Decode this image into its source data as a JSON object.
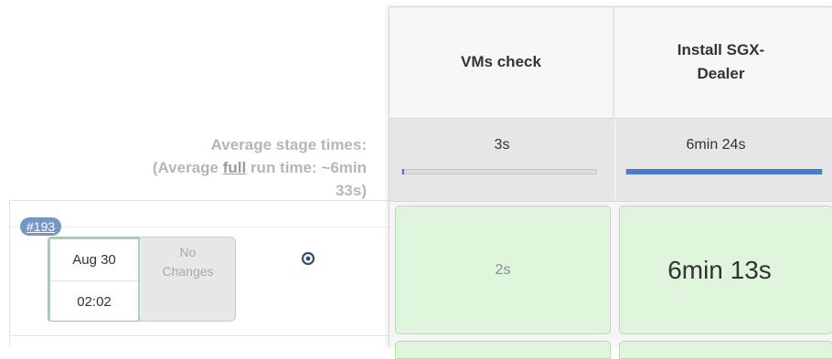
{
  "summary": {
    "avg_stage_label": "Average stage times:",
    "avg_full_prefix": "(Average ",
    "avg_full_link": "full",
    "avg_full_suffix": " run time: ~6min",
    "avg_full_last": "33s)"
  },
  "build": {
    "number": "#193",
    "date": "Aug 30",
    "time": "02:02",
    "changes_line1": "No",
    "changes_line2": "Changes",
    "info_icon": "info-circle-icon"
  },
  "stages": [
    {
      "name": "VMs check",
      "avg_time": "3s",
      "avg_bar_fraction": 0.01,
      "result_time": "2s"
    },
    {
      "name": "Install SGX-Dealer",
      "avg_time": "6min 24s",
      "avg_bar_fraction": 1.0,
      "result_time": "6min 13s"
    }
  ],
  "colors": {
    "success_fill": "#dff6dd",
    "success_border": "#b8dcb5",
    "progress_bar": "#4a7cc7",
    "build_badge": "#7597c6"
  }
}
